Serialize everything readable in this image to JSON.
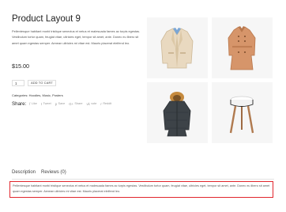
{
  "product": {
    "title": "Product Layout 9",
    "short_description": "Pellentesque habitant morbi tristique senectus et netus et malesuada fames ac turpis egestas. Vestibulum tortor quam, feugiat vitae, ultricies eget, tempor sit amet, ante. Donec eu libero sit amet quam egestas semper. Aenean ultricies mi vitae est. Mauris placerat eleifend leo.",
    "price": "$15.00",
    "quantity": "1",
    "add_to_cart_label": "ADD TO CART",
    "categories_text": "Categories: Hoodies, Music, Posters"
  },
  "share": {
    "label": "Share:",
    "items": [
      {
        "icon": "facebook-icon",
        "glyph": "f",
        "label": "Like"
      },
      {
        "icon": "twitter-icon",
        "glyph": "t",
        "label": "Tweet"
      },
      {
        "icon": "pinterest-icon",
        "glyph": "p",
        "label": "Save"
      },
      {
        "icon": "google-plus-icon",
        "glyph": "G+",
        "label": "Share"
      },
      {
        "icon": "vk-icon",
        "glyph": "vk",
        "label": "vote"
      },
      {
        "icon": "reddit-icon",
        "glyph": "r",
        "label": "Reddit"
      }
    ]
  },
  "gallery": [
    {
      "name": "blazer-image"
    },
    {
      "name": "trench-coat-image"
    },
    {
      "name": "parka-image"
    },
    {
      "name": "stool-image"
    }
  ],
  "tabs": [
    {
      "label": "Description"
    },
    {
      "label": "Reviews (0)"
    }
  ],
  "tab_content": {
    "description": "Pellentesque habitant morbi tristique senectus et netus et malesuada fames ac turpis egestas. Vestibulum tortor quam, feugiat vitae, ultricies eget, tempor sit amet, ante. Donec eu libero sit amet quam egestas semper. Aenean ultricies mi vitae est. Mauris placerat eleifend leo."
  },
  "colors": {
    "highlight_border": "#e1262d",
    "tile_background": "#f6f6f6"
  }
}
